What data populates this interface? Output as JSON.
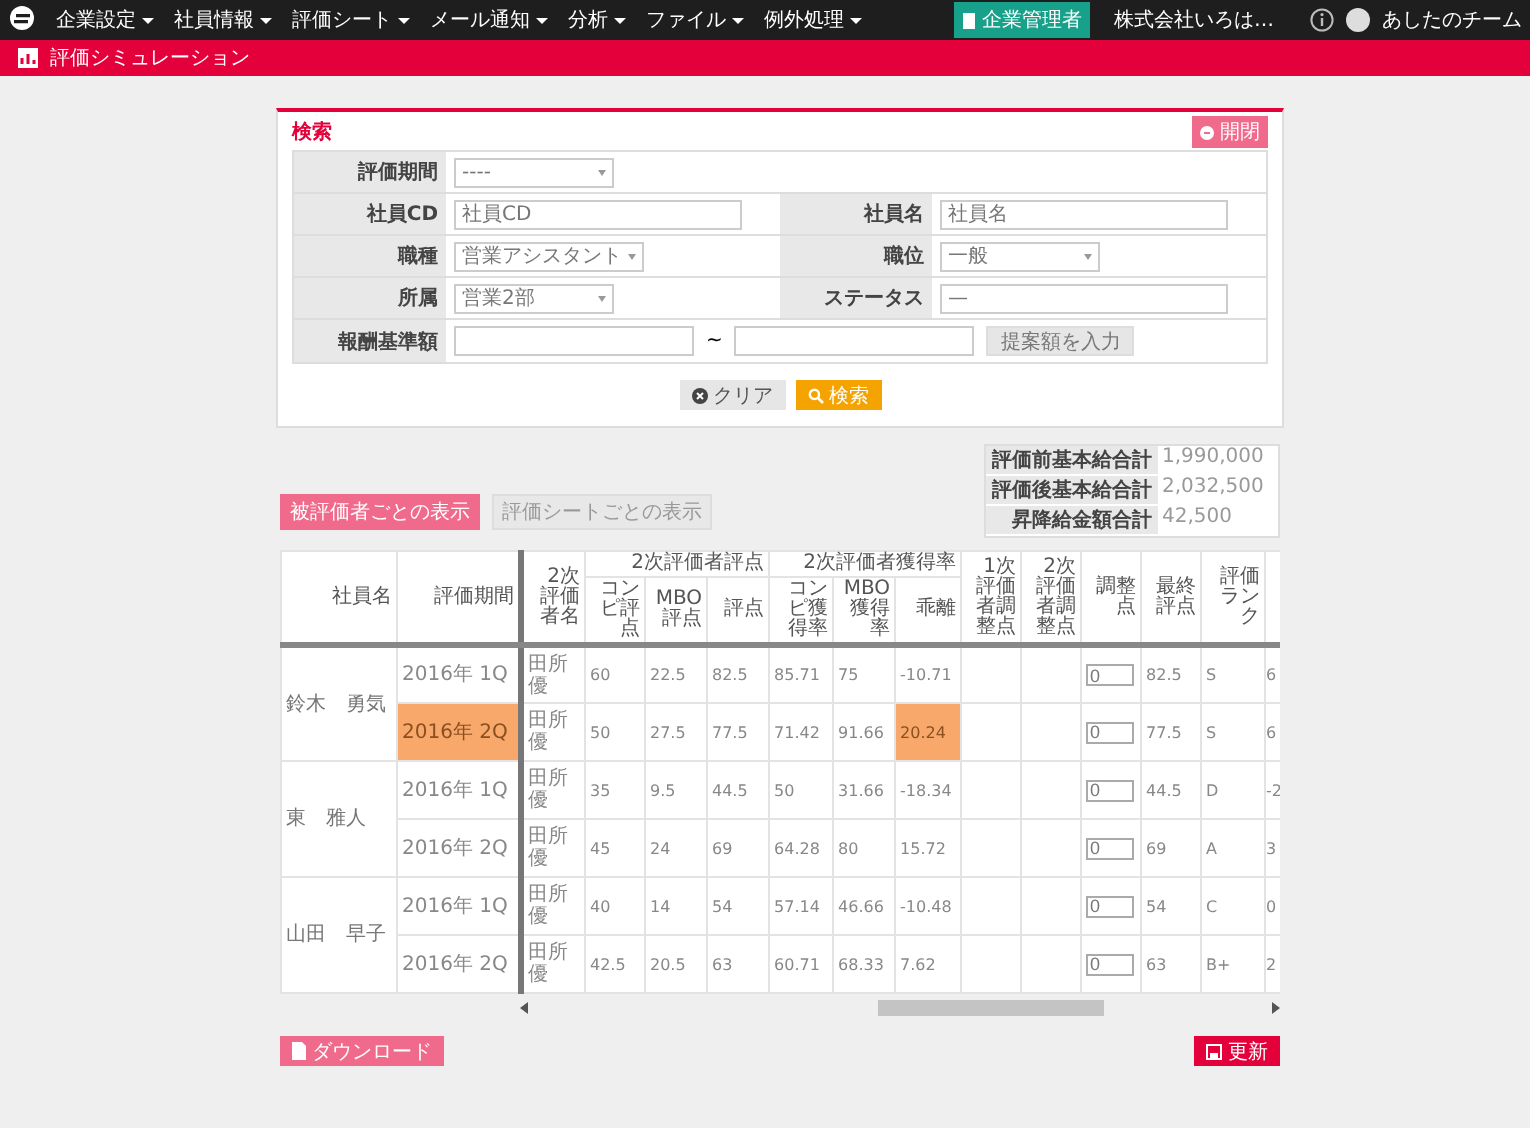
{
  "nav": {
    "menu": [
      "企業設定",
      "社員情報",
      "評価シート",
      "メール通知",
      "分析",
      "ファイル",
      "例外処理"
    ],
    "role_badge": "企業管理者",
    "company": "株式会社いろは…",
    "user": "あしたのチーム"
  },
  "page_title": "評価シミュレーション",
  "search": {
    "title": "検索",
    "toggle_button": "開閉",
    "rows": [
      {
        "fields": [
          {
            "label": "評価期間",
            "kind": "select",
            "value": "----"
          }
        ]
      },
      {
        "fields": [
          {
            "label": "社員CD",
            "kind": "text",
            "placeholder": "社員CD"
          },
          {
            "label": "社員名",
            "kind": "text",
            "placeholder": "社員名"
          }
        ]
      },
      {
        "fields": [
          {
            "label": "職種",
            "kind": "select",
            "value": "営業アシスタント"
          },
          {
            "label": "職位",
            "kind": "select",
            "value": "一般"
          }
        ]
      },
      {
        "fields": [
          {
            "label": "所属",
            "kind": "select",
            "value": "営業2部"
          },
          {
            "label": "ステータス",
            "kind": "text",
            "value": "—"
          }
        ]
      },
      {
        "fields": [
          {
            "label": "報酬基準額",
            "kind": "range",
            "separator": "~",
            "button": "提案額を入力"
          }
        ]
      }
    ],
    "buttons": [
      {
        "label": "クリア",
        "kind": "clear"
      },
      {
        "label": "検索",
        "kind": "search"
      }
    ]
  },
  "totals": [
    {
      "label": "評価前基本給合計",
      "value": "1,990,000"
    },
    {
      "label": "評価後基本給合計",
      "value": "2,032,500"
    },
    {
      "label": "昇降給金額合計",
      "value": "42,500"
    }
  ],
  "view_tabs": [
    {
      "label": "被評価者ごとの表示",
      "selected": true
    },
    {
      "label": "評価シートごとの表示",
      "selected": false
    }
  ],
  "table": {
    "columns": [
      {
        "label": "社員名"
      },
      {
        "label": "評価期間"
      },
      {
        "label": "2次評価者名"
      },
      {
        "label": "2次評価者評点",
        "children": [
          "コンピ評点",
          "MBO評点",
          "評点"
        ]
      },
      {
        "label": "2次評価者獲得率",
        "children": [
          "コンピ獲得率",
          "MBO獲得率",
          "乖離"
        ]
      },
      {
        "label": "1次評価者調整点"
      },
      {
        "label": "2次評価者調整点"
      },
      {
        "label": "調整点"
      },
      {
        "label": "最終評点"
      },
      {
        "label": "評価ランク"
      }
    ],
    "employees": [
      {
        "name": "鈴木　勇気",
        "rows": [
          {
            "period": "2016年 1Q",
            "period_highlighted": false,
            "evaluator": "田所優",
            "values": [
              {
                "text": "60",
                "highlighted": false
              },
              {
                "text": "22.5",
                "highlighted": false
              },
              {
                "text": "82.5",
                "highlighted": false
              },
              {
                "text": "85.71",
                "highlighted": false
              },
              {
                "text": "75",
                "highlighted": false
              },
              {
                "text": "-10.71",
                "highlighted": false
              }
            ],
            "adjustment": "0",
            "final": "82.5",
            "rank": "S",
            "column_15": "6"
          },
          {
            "period": "2016年 2Q",
            "period_highlighted": true,
            "evaluator": "田所優",
            "values": [
              {
                "text": "50",
                "highlighted": false
              },
              {
                "text": "27.5",
                "highlighted": false
              },
              {
                "text": "77.5",
                "highlighted": false
              },
              {
                "text": "71.42",
                "highlighted": false
              },
              {
                "text": "91.66",
                "highlighted": false
              },
              {
                "text": "20.24",
                "highlighted": true
              }
            ],
            "adjustment": "0",
            "final": "77.5",
            "rank": "S",
            "column_15": "6"
          }
        ]
      },
      {
        "name": "東　雅人",
        "rows": [
          {
            "period": "2016年 1Q",
            "period_highlighted": false,
            "evaluator": "田所優",
            "values": [
              {
                "text": "35",
                "highlighted": false
              },
              {
                "text": "9.5",
                "highlighted": false
              },
              {
                "text": "44.5",
                "highlighted": false
              },
              {
                "text": "50",
                "highlighted": false
              },
              {
                "text": "31.66",
                "highlighted": false
              },
              {
                "text": "-18.34",
                "highlighted": false
              }
            ],
            "adjustment": "0",
            "final": "44.5",
            "rank": "D",
            "column_15": "-2"
          },
          {
            "period": "2016年 2Q",
            "period_highlighted": false,
            "evaluator": "田所優",
            "values": [
              {
                "text": "45",
                "highlighted": false
              },
              {
                "text": "24",
                "highlighted": false
              },
              {
                "text": "69",
                "highlighted": false
              },
              {
                "text": "64.28",
                "highlighted": false
              },
              {
                "text": "80",
                "highlighted": false
              },
              {
                "text": "15.72",
                "highlighted": false
              }
            ],
            "adjustment": "0",
            "final": "69",
            "rank": "A",
            "column_15": "3"
          }
        ]
      },
      {
        "name": "山田　早子",
        "rows": [
          {
            "period": "2016年 1Q",
            "period_highlighted": false,
            "evaluator": "田所優",
            "values": [
              {
                "text": "40",
                "highlighted": false
              },
              {
                "text": "14",
                "highlighted": false
              },
              {
                "text": "54",
                "highlighted": false
              },
              {
                "text": "57.14",
                "highlighted": false
              },
              {
                "text": "46.66",
                "highlighted": false
              },
              {
                "text": "-10.48",
                "highlighted": false
              }
            ],
            "adjustment": "0",
            "final": "54",
            "rank": "C",
            "column_15": "0"
          },
          {
            "period": "2016年 2Q",
            "period_highlighted": false,
            "evaluator": "田所優",
            "values": [
              {
                "text": "42.5",
                "highlighted": false
              },
              {
                "text": "20.5",
                "highlighted": false
              },
              {
                "text": "63",
                "highlighted": false
              },
              {
                "text": "60.71",
                "highlighted": false
              },
              {
                "text": "68.33",
                "highlighted": false
              },
              {
                "text": "7.62",
                "highlighted": false
              }
            ],
            "adjustment": "0",
            "final": "63",
            "rank": "B+",
            "column_15": "2"
          }
        ]
      }
    ]
  },
  "footer": {
    "download_button": "ダウンロード",
    "update_button": "更新"
  }
}
